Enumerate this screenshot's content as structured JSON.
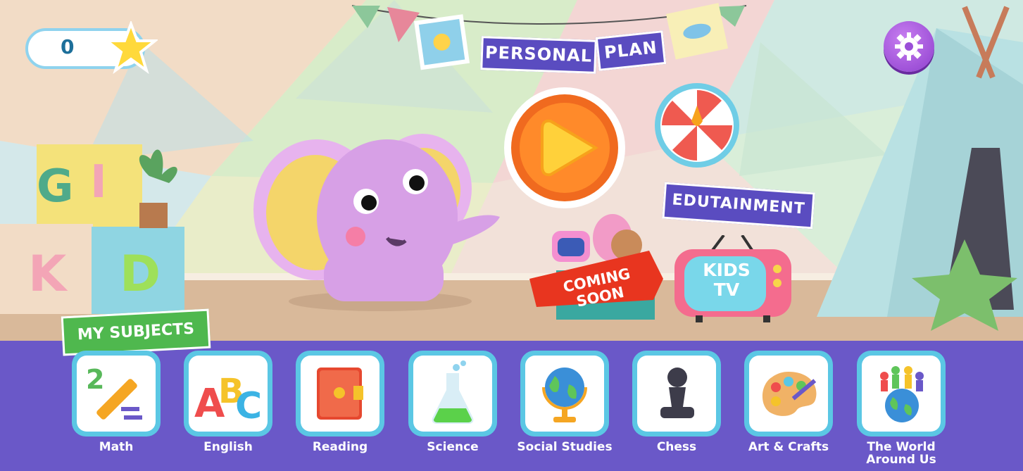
{
  "score": {
    "value": "0"
  },
  "banners": {
    "personal": "PERSONAL",
    "plan": "PLAN",
    "edutainment": "EDUTAINMENT",
    "my_subjects": "MY SUBJECTS"
  },
  "cards": {
    "coming_soon": "COMING SOON",
    "kids_tv_line1": "KIDS",
    "kids_tv_line2": "TV"
  },
  "blocks": {
    "g": "G",
    "i": "I",
    "k": "K",
    "d": "D"
  },
  "subjects": [
    {
      "label": "Math",
      "icon": "math-icon"
    },
    {
      "label": "English",
      "icon": "english-abc-icon"
    },
    {
      "label": "Reading",
      "icon": "book-icon"
    },
    {
      "label": "Science",
      "icon": "flask-icon"
    },
    {
      "label": "Social Studies",
      "icon": "globe-icon"
    },
    {
      "label": "Chess",
      "icon": "chess-pawn-icon"
    },
    {
      "label": "Art & Crafts",
      "icon": "palette-icon"
    },
    {
      "label": "The World Around Us",
      "icon": "world-people-icon"
    }
  ],
  "colors": {
    "bar": "#6a58c8",
    "tile": "#5bc7e4",
    "banner": "#5a4cc0",
    "subjects_banner": "#4fb84e",
    "settings": "#9b4fd8"
  }
}
